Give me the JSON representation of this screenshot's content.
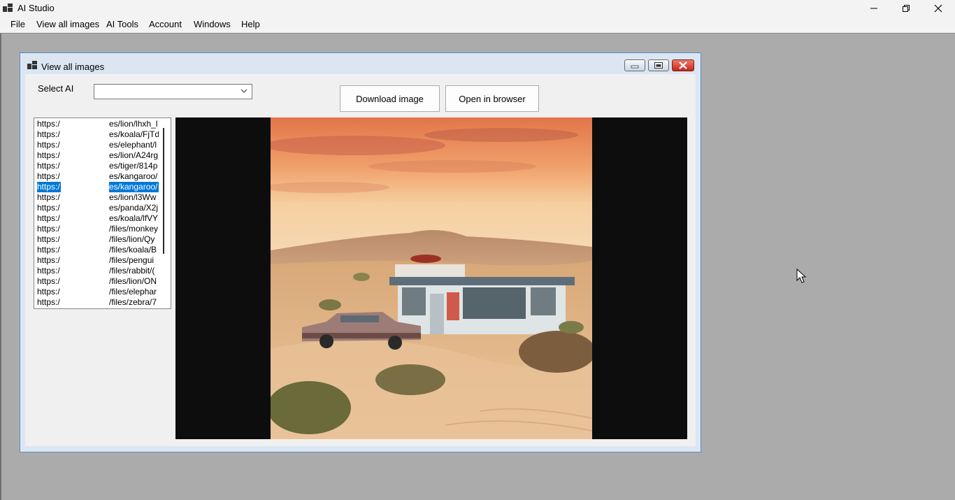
{
  "app": {
    "title": "AI Studio"
  },
  "menu": {
    "items": [
      "File",
      "View all images",
      "AI Tools",
      "Account",
      "Windows",
      "Help"
    ]
  },
  "child_window": {
    "title": "View all images",
    "select_label": "Select AI",
    "select_value": "",
    "download_button": "Download image",
    "open_button": "Open in browser",
    "selected_index": 6,
    "urls": [
      {
        "a": "https:/",
        "b": "es/lion/lhxh_l"
      },
      {
        "a": "https:/",
        "b": "es/koala/FjTd"
      },
      {
        "a": "https:/",
        "b": "es/elephant/l"
      },
      {
        "a": "https:/",
        "b": "es/lion/A24rg"
      },
      {
        "a": "https:/",
        "b": "es/tiger/814p"
      },
      {
        "a": "https:/",
        "b": "es/kangaroo/"
      },
      {
        "a": "https:/",
        "b": "es/kangaroo/"
      },
      {
        "a": "https:/",
        "b": "es/lion/l3Ww"
      },
      {
        "a": "https:/",
        "b": "es/panda/X2j"
      },
      {
        "a": "https:/",
        "b": "es/koala/lfVY"
      },
      {
        "a": "https:/",
        "b": "/files/monkey"
      },
      {
        "a": "https:/",
        "b": "/files/lion/Qy"
      },
      {
        "a": "https:/",
        "b": "/files/koala/B"
      },
      {
        "a": "https:/",
        "b": "/files/pengui"
      },
      {
        "a": "https:/",
        "b": "/files/rabbit/("
      },
      {
        "a": "https:/",
        "b": "/files/lion/ON"
      },
      {
        "a": "https:/",
        "b": "/files/elephar"
      },
      {
        "a": "https:/",
        "b": "/files/zebra/7"
      }
    ]
  },
  "colors": {
    "selection": "#0078d7",
    "mdi_background": "#ababab",
    "image_background": "#0d0d0d"
  }
}
